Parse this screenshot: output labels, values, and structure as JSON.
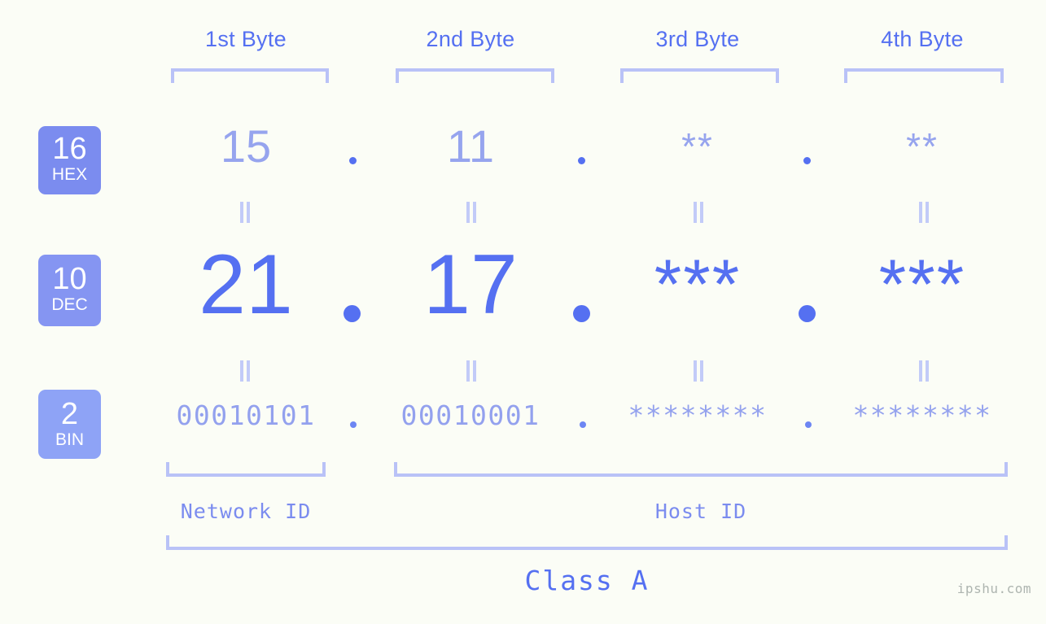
{
  "watermark": "ipshu.com",
  "byte_headers": [
    {
      "label": "1st Byte"
    },
    {
      "label": "2nd Byte"
    },
    {
      "label": "3rd Byte"
    },
    {
      "label": "4th Byte"
    }
  ],
  "bases": [
    {
      "num": "16",
      "name": "HEX",
      "color": "#7b8cef"
    },
    {
      "num": "10",
      "name": "DEC",
      "color": "#8595f2"
    },
    {
      "num": "2",
      "name": "BIN",
      "color": "#8ea3f6"
    }
  ],
  "rows": {
    "hex": {
      "base": "16",
      "base_name": "HEX",
      "values": [
        "15",
        "11",
        "**",
        "**"
      ],
      "separator": "."
    },
    "dec": {
      "base": "10",
      "base_name": "DEC",
      "values": [
        "21",
        "17",
        "***",
        "***"
      ],
      "separator": "."
    },
    "bin": {
      "base": "2",
      "base_name": "BIN",
      "values": [
        "00010101",
        "00010001",
        "********",
        "********"
      ],
      "separator": "."
    }
  },
  "equality_marks": {
    "hex_to_dec": "=",
    "dec_to_bin": "="
  },
  "segments": {
    "network_id": "Network ID",
    "host_id": "Host ID"
  },
  "class_label": "Class A",
  "colors": {
    "background": "#fbfdf6",
    "accent_strong": "#5570f1",
    "accent_light": "#96a4ee",
    "bracket": "#b9c2f7",
    "equals": "#c2cbf8",
    "watermark": "#aeb5b0"
  }
}
